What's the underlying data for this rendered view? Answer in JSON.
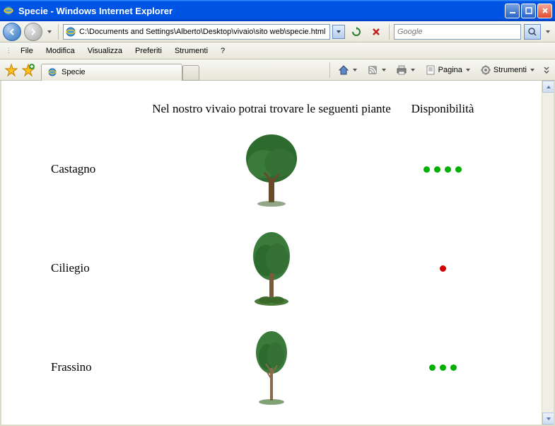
{
  "titlebar": {
    "title": "Specie - Windows Internet Explorer"
  },
  "navbar": {
    "address": "C:\\Documents and Settings\\Alberto\\Desktop\\vivaio\\sito web\\specie.html",
    "search_placeholder": "Google"
  },
  "menubar": {
    "items": [
      "File",
      "Modifica",
      "Visualizza",
      "Preferiti",
      "Strumenti",
      "?"
    ]
  },
  "toolbar": {
    "tab_title": "Specie",
    "pagina_label": "Pagina",
    "strumenti_label": "Strumenti"
  },
  "page": {
    "heading": "Nel nostro vivaio potrai trovare le seguenti piante",
    "availability_label": "Disponibilità",
    "species": [
      {
        "name": "Castagno",
        "avail_count": 4,
        "avail_color": "green"
      },
      {
        "name": "Ciliegio",
        "avail_count": 1,
        "avail_color": "red"
      },
      {
        "name": "Frassino",
        "avail_count": 3,
        "avail_color": "green"
      }
    ]
  }
}
